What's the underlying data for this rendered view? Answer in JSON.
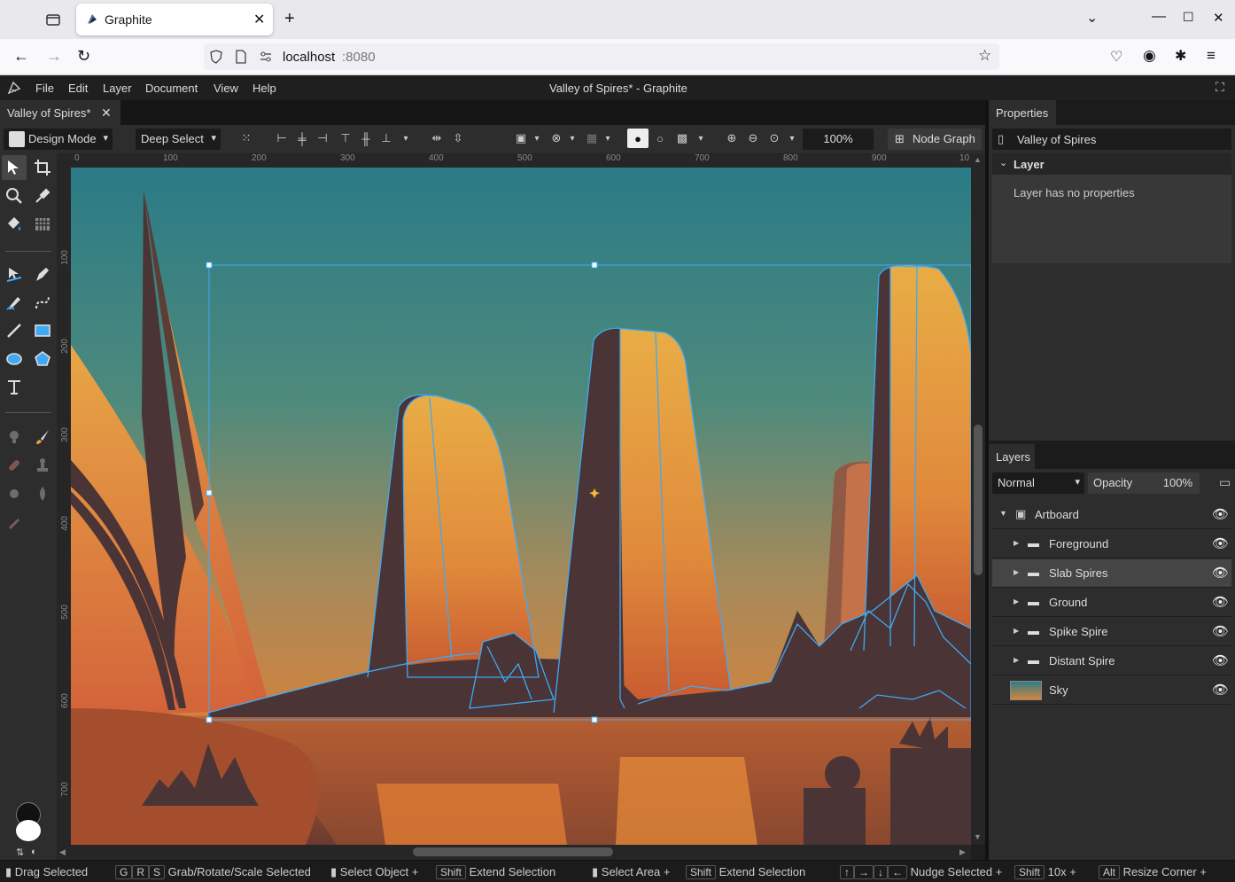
{
  "browser": {
    "tab_title": "Graphite",
    "url_host": "localhost",
    "url_port": ":8080"
  },
  "app": {
    "window_title": "Valley of Spires* - Graphite",
    "menu": [
      "File",
      "Edit",
      "Layer",
      "Document",
      "View",
      "Help"
    ],
    "document_tab": "Valley of Spires*"
  },
  "toolbar": {
    "mode": "Design Mode",
    "select_mode": "Deep Select",
    "zoom": "100%",
    "node_graph": "Node Graph"
  },
  "rulers": {
    "h_labels": [
      "0",
      "100",
      "200",
      "300",
      "400",
      "500",
      "600",
      "700",
      "800",
      "900",
      "10"
    ],
    "v_labels": [
      "100",
      "200",
      "300",
      "400",
      "500",
      "600",
      "700"
    ]
  },
  "properties": {
    "tab": "Properties",
    "document_name": "Valley of Spires",
    "section": "Layer",
    "message": "Layer has no properties"
  },
  "layers": {
    "tab": "Layers",
    "blend_mode": "Normal",
    "opacity_label": "Opacity",
    "opacity_value": "100%",
    "items": [
      {
        "name": "Artboard"
      },
      {
        "name": "Foreground"
      },
      {
        "name": "Slab Spires"
      },
      {
        "name": "Ground"
      },
      {
        "name": "Spike Spire"
      },
      {
        "name": "Distant Spire"
      },
      {
        "name": "Sky"
      }
    ]
  },
  "status": {
    "drag": "Drag Selected",
    "grs_keys": [
      "G",
      "R",
      "S"
    ],
    "grs": "Grab/Rotate/Scale Selected",
    "select_object": "Select Object",
    "shift": "Shift",
    "extend": "Extend Selection",
    "select_area": "Select Area",
    "nudge": "Nudge Selected",
    "tenx": "10x",
    "alt": "Alt",
    "resize": "Resize Corner"
  },
  "colors": {
    "accent": "#3fa9f5",
    "sky_top": "#2b7d88",
    "sky_bottom": "#d8833c",
    "spire_dark": "#4a3436",
    "spire_face": "#e7a540"
  }
}
